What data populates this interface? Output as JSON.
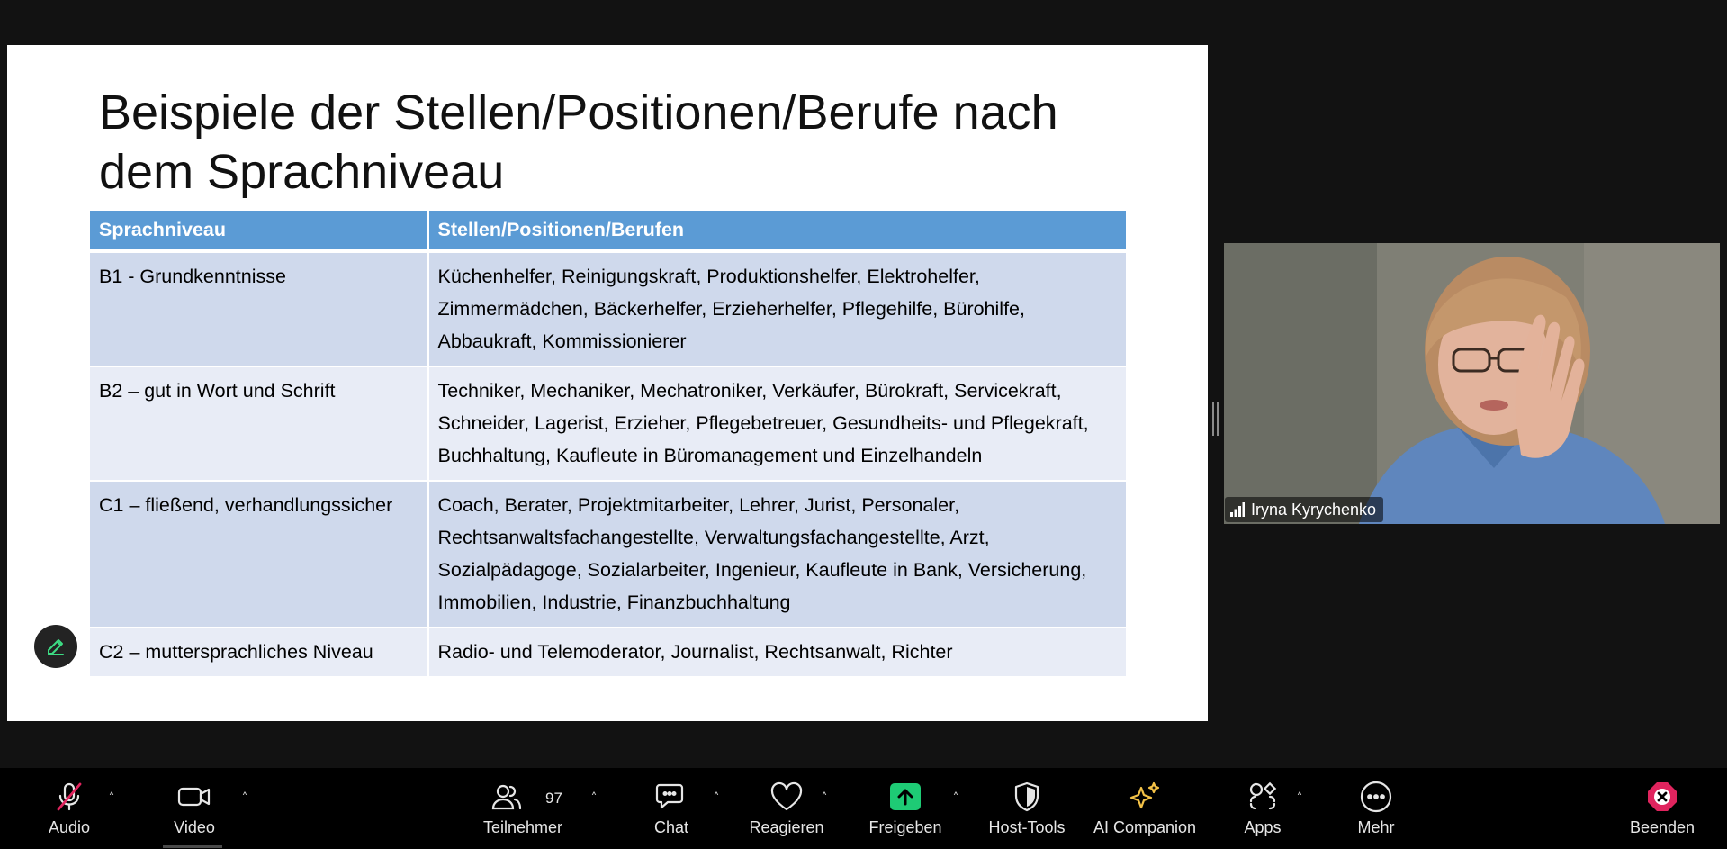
{
  "slide": {
    "title": "Beispiele der Stellen/Positionen/Berufe nach dem Sprachniveau",
    "table": {
      "headers": [
        "Sprachniveau",
        "Stellen/Positionen/Berufen"
      ],
      "rows": [
        {
          "level": "B1 - Grundkenntnisse",
          "jobs": "Küchenhelfer, Reinigungskraft, Produktionshelfer, Elektrohelfer, Zimmermädchen, Bäckerhelfer, Erzieherhelfer, Pflegehilfe, Bürohilfe, Abbaukraft, Kommissionierer"
        },
        {
          "level": "B2 – gut in Wort und Schrift",
          "jobs": "Techniker, Mechaniker, Mechatroniker, Verkäufer, Bürokraft, Servicekraft, Schneider, Lagerist, Erzieher, Pflegebetreuer, Gesundheits- und Pflegekraft, Buchhaltung, Kaufleute in Büromanagement und Einzelhandeln"
        },
        {
          "level": "C1 – fließend, verhandlungssicher",
          "jobs": "Coach, Berater, Projektmitarbeiter, Lehrer, Jurist, Personaler, Rechtsanwaltsfachangestellte, Verwaltungsfachangestellte, Arzt, Sozialpädagoge, Sozialarbeiter, Ingenieur, Kaufleute in Bank, Versicherung, Immobilien, Industrie, Finanzbuchhaltung"
        },
        {
          "level": "C2 – muttersprachliches Niveau",
          "jobs": "Radio- und Telemoderator, Journalist, Rechtsanwalt, Richter"
        }
      ]
    }
  },
  "video": {
    "participant_name": "Iryna Kyrychenko"
  },
  "toolbar": {
    "audio": "Audio",
    "video": "Video",
    "participants": "Teilnehmer",
    "participants_count": "97",
    "chat": "Chat",
    "react": "Reagieren",
    "share": "Freigeben",
    "host_tools": "Host-Tools",
    "ai_companion": "AI Companion",
    "apps": "Apps",
    "more": "Mehr",
    "end": "Beenden"
  },
  "colors": {
    "table_header": "#5b9bd5",
    "row_odd": "#cfd9ec",
    "row_even": "#e8ecf6",
    "share_green": "#1ecb75",
    "ai_gold": "#f4c247",
    "end_red": "#e0245e",
    "muted_red": "#e0245e"
  }
}
